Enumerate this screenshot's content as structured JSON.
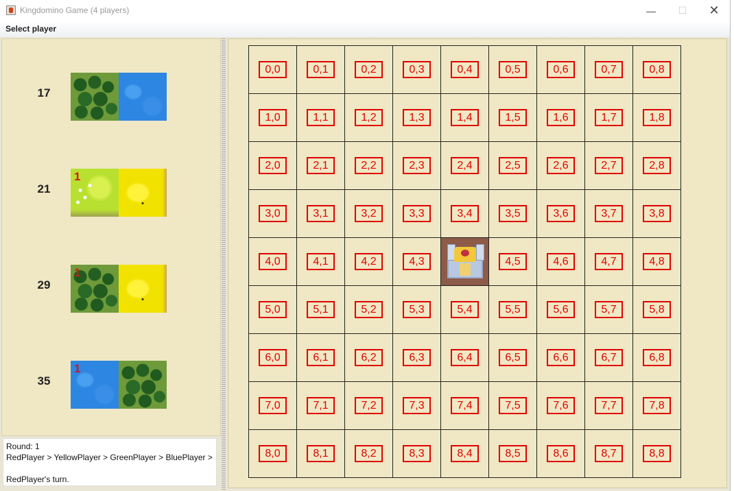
{
  "window": {
    "title": "Kingdomino Game (4 players)",
    "minimize_glyph": "—",
    "maximize_glyph": "☐",
    "close_glyph": "✕"
  },
  "menu": {
    "label": "Select player"
  },
  "dominoes": [
    {
      "number": "17",
      "left": {
        "terrain": "forest",
        "crowns": ""
      },
      "right": {
        "terrain": "water",
        "crowns": ""
      }
    },
    {
      "number": "21",
      "left": {
        "terrain": "meadow",
        "crowns": "1"
      },
      "right": {
        "terrain": "field",
        "crowns": ""
      }
    },
    {
      "number": "29",
      "left": {
        "terrain": "forest",
        "crowns": "1"
      },
      "right": {
        "terrain": "field",
        "crowns": ""
      }
    },
    {
      "number": "35",
      "left": {
        "terrain": "water",
        "crowns": "1"
      },
      "right": {
        "terrain": "forest",
        "crowns": ""
      }
    }
  ],
  "status": {
    "round": "Round: 1",
    "order": "RedPlayer > YellowPlayer > GreenPlayer > BluePlayer >",
    "blank": "",
    "turn": "RedPlayer's turn."
  },
  "board": {
    "castle_cell": "4,4",
    "rows": [
      [
        "0,0",
        "0,1",
        "0,2",
        "0,3",
        "0,4",
        "0,5",
        "0,6",
        "0,7",
        "0,8"
      ],
      [
        "1,0",
        "1,1",
        "1,2",
        "1,3",
        "1,4",
        "1,5",
        "1,6",
        "1,7",
        "1,8"
      ],
      [
        "2,0",
        "2,1",
        "2,2",
        "2,3",
        "2,4",
        "2,5",
        "2,6",
        "2,7",
        "2,8"
      ],
      [
        "3,0",
        "3,1",
        "3,2",
        "3,3",
        "3,4",
        "3,5",
        "3,6",
        "3,7",
        "3,8"
      ],
      [
        "4,0",
        "4,1",
        "4,2",
        "4,3",
        "",
        "4,5",
        "4,6",
        "4,7",
        "4,8"
      ],
      [
        "5,0",
        "5,1",
        "5,2",
        "5,3",
        "5,4",
        "5,5",
        "5,6",
        "5,7",
        "5,8"
      ],
      [
        "6,0",
        "6,1",
        "6,2",
        "6,3",
        "6,4",
        "6,5",
        "6,6",
        "6,7",
        "6,8"
      ],
      [
        "7,0",
        "7,1",
        "7,2",
        "7,3",
        "7,4",
        "7,5",
        "7,6",
        "7,7",
        "7,8"
      ],
      [
        "8,0",
        "8,1",
        "8,2",
        "8,3",
        "8,4",
        "8,5",
        "8,6",
        "8,7",
        "8,8"
      ]
    ]
  },
  "colors": {
    "panel_bg": "#f0e7c4",
    "cell_label": "#e00000",
    "crown": "#e01010"
  }
}
